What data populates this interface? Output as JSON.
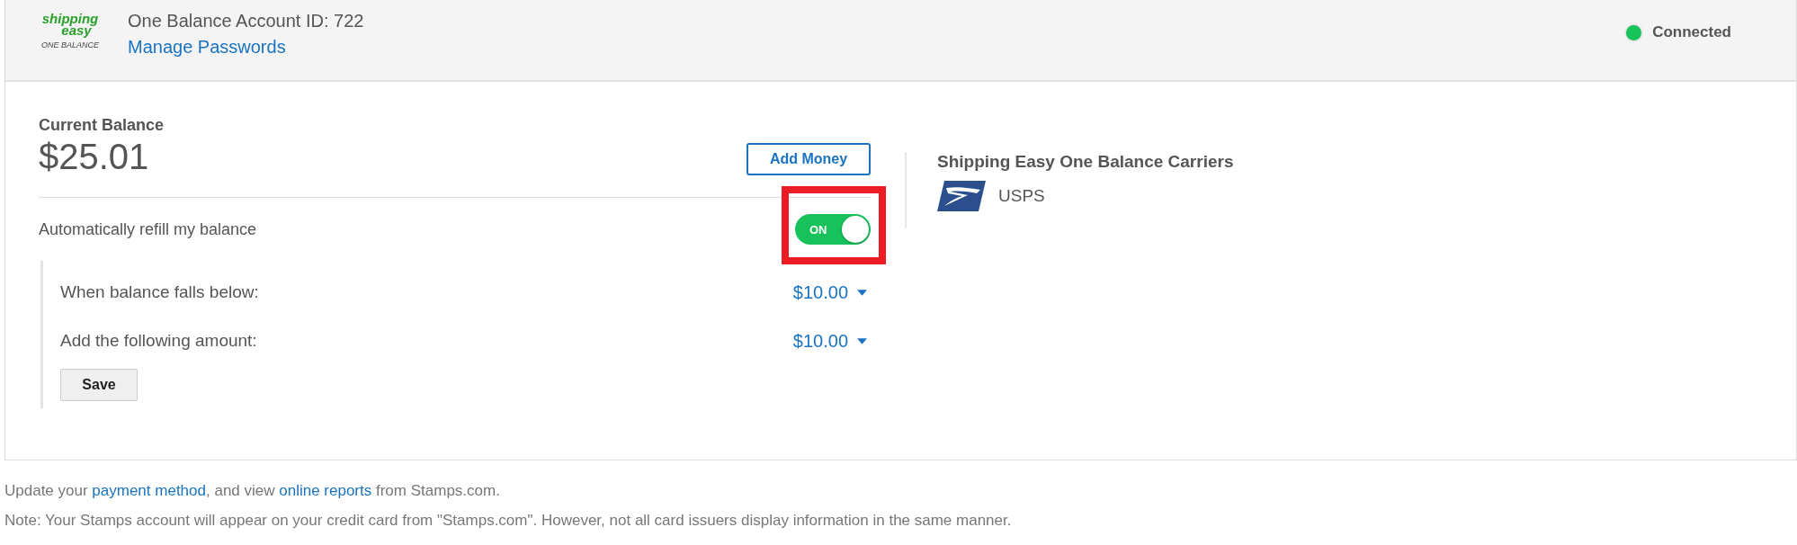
{
  "header": {
    "logo": {
      "wordmark_top": "shipping",
      "wordmark_bottom": "easy",
      "tagline": "ONE BALANCE"
    },
    "account_id": "One Balance Account ID: 722",
    "manage_link": "Manage Passwords",
    "status": {
      "label": "Connected",
      "color": "#16c45a"
    }
  },
  "balance": {
    "label": "Current Balance",
    "amount": "$25.01",
    "add_button": "Add Money"
  },
  "auto_refill": {
    "label": "Automatically refill my balance",
    "toggle": {
      "on": true,
      "text": "ON",
      "highlighted": true
    },
    "rows": [
      {
        "label": "When balance falls below:",
        "value": "$10.00"
      },
      {
        "label": "Add the following amount:",
        "value": "$10.00"
      }
    ],
    "save_button": "Save"
  },
  "carriers": {
    "title": "Shipping Easy One Balance Carriers",
    "items": [
      {
        "name": "USPS"
      }
    ]
  },
  "footer": {
    "line1": [
      "Update your ",
      {
        "link": "payment method"
      },
      ", and view ",
      {
        "link": "online reports"
      },
      " from Stamps.com."
    ],
    "line2": "Note: Your Stamps account will appear on your credit card from \"Stamps.com\". However, not all card issuers display information in the same manner."
  }
}
